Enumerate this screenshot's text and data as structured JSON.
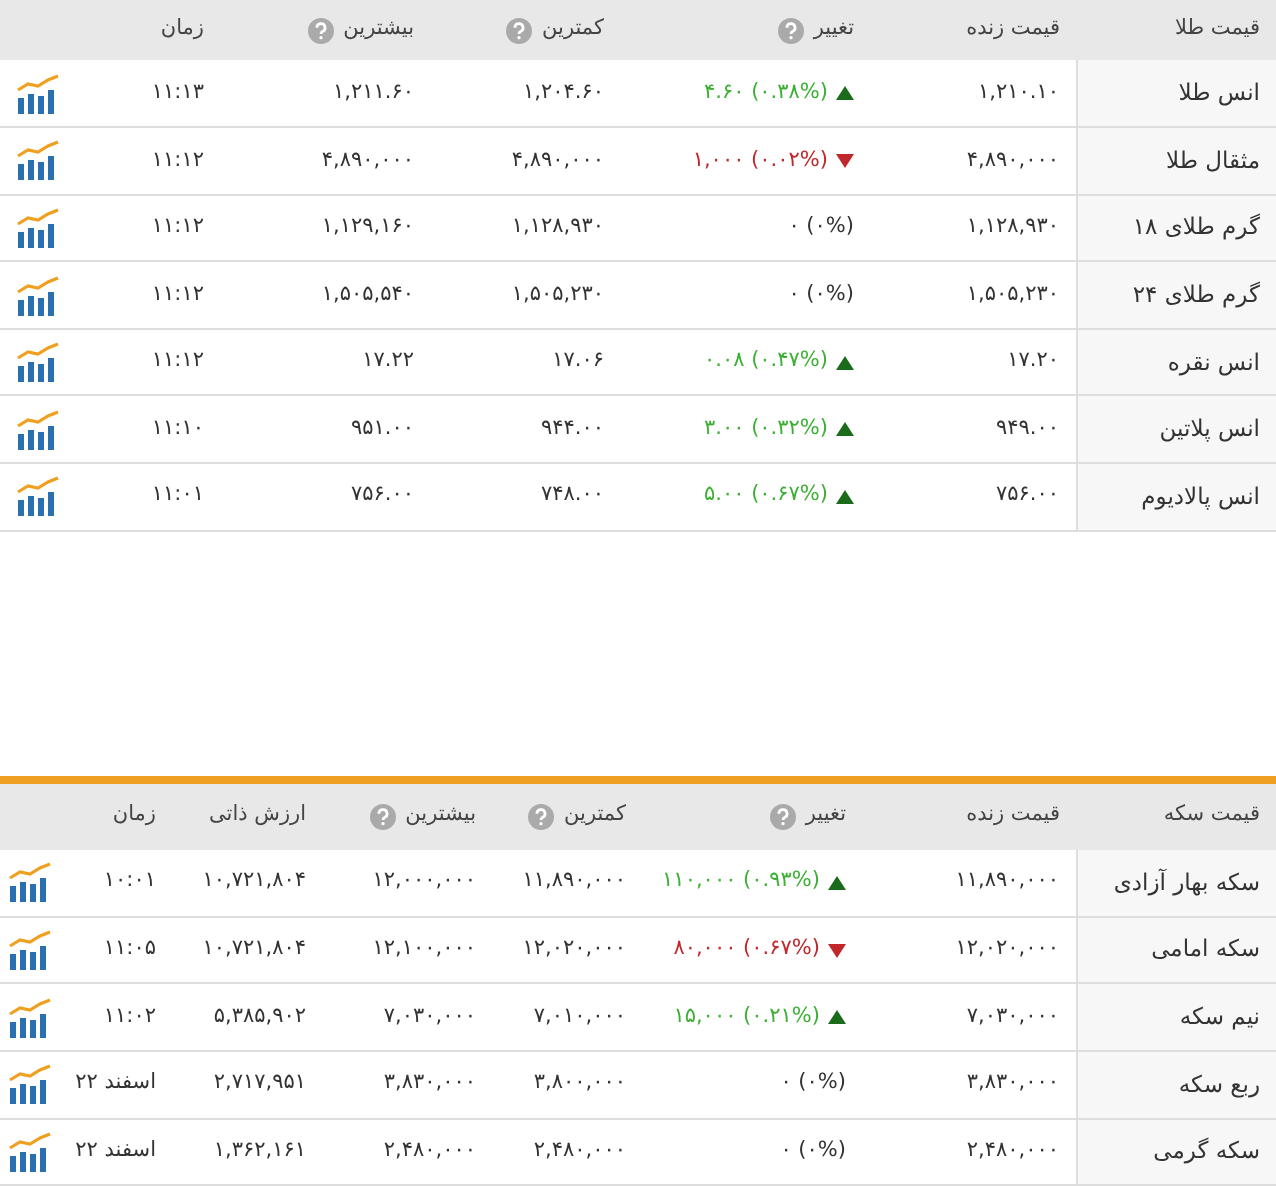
{
  "tables": [
    {
      "columns": [
        {
          "label": "قیمت طلا",
          "help": false
        },
        {
          "label": "قیمت زنده",
          "help": false
        },
        {
          "label": "تغییر",
          "help": true
        },
        {
          "label": "کمترین",
          "help": true
        },
        {
          "label": "بیشترین",
          "help": true
        },
        {
          "label": "زمان",
          "help": false
        }
      ],
      "rows": [
        {
          "rising": true,
          "falling": false,
          "cells": [
            "انس طلا",
            "۱,۲۱۰.۱۰",
            "۴.۶۰ (۰.۳۸%)",
            "۱,۲۰۴.۶۰",
            "۱,۲۱۱.۶۰",
            "۱۱:۱۳"
          ]
        },
        {
          "rising": false,
          "falling": true,
          "cells": [
            "مثقال طلا",
            "۴,۸۹۰,۰۰۰",
            "۱,۰۰۰ (۰.۰۲%)",
            "۴,۸۹۰,۰۰۰",
            "۴,۸۹۰,۰۰۰",
            "۱۱:۱۲"
          ]
        },
        {
          "rising": false,
          "falling": false,
          "cells": [
            "گرم طلای ۱۸",
            "۱,۱۲۸,۹۳۰",
            "۰ (۰%)",
            "۱,۱۲۸,۹۳۰",
            "۱,۱۲۹,۱۶۰",
            "۱۱:۱۲"
          ]
        },
        {
          "rising": false,
          "falling": false,
          "cells": [
            "گرم طلای ۲۴",
            "۱,۵۰۵,۲۳۰",
            "۰ (۰%)",
            "۱,۵۰۵,۲۳۰",
            "۱,۵۰۵,۵۴۰",
            "۱۱:۱۲"
          ]
        },
        {
          "rising": true,
          "falling": false,
          "cells": [
            "انس نقره",
            "۱۷.۲۰",
            "۰.۰۸ (۰.۴۷%)",
            "۱۷.۰۶",
            "۱۷.۲۲",
            "۱۱:۱۲"
          ]
        },
        {
          "rising": true,
          "falling": false,
          "cells": [
            "انس پلاتین",
            "۹۴۹.۰۰",
            "۳.۰۰ (۰.۳۲%)",
            "۹۴۴.۰۰",
            "۹۵۱.۰۰",
            "۱۱:۱۰"
          ]
        },
        {
          "rising": true,
          "falling": false,
          "cells": [
            "انس پالادیوم",
            "۷۵۶.۰۰",
            "۵.۰۰ (۰.۶۷%)",
            "۷۴۸.۰۰",
            "۷۵۶.۰۰",
            "۱۱:۰۱"
          ]
        }
      ]
    },
    {
      "columns": [
        {
          "label": "قیمت سکه",
          "help": false
        },
        {
          "label": "قیمت زنده",
          "help": false
        },
        {
          "label": "تغییر",
          "help": true
        },
        {
          "label": "کمترین",
          "help": true
        },
        {
          "label": "بیشترین",
          "help": true
        },
        {
          "label": "ارزش ذاتی",
          "help": false
        },
        {
          "label": "زمان",
          "help": false
        }
      ],
      "rows": [
        {
          "rising": true,
          "falling": false,
          "cells": [
            "سکه بهار آزادی",
            "۱۱,۸۹۰,۰۰۰",
            "۱۱۰,۰۰۰ (۰.۹۳%)",
            "۱۱,۸۹۰,۰۰۰",
            "۱۲,۰۰۰,۰۰۰",
            "۱۰,۷۲۱,۸۰۴",
            "۱۰:۰۱"
          ]
        },
        {
          "rising": false,
          "falling": true,
          "cells": [
            "سکه امامی",
            "۱۲,۰۲۰,۰۰۰",
            "۸۰,۰۰۰ (۰.۶۷%)",
            "۱۲,۰۲۰,۰۰۰",
            "۱۲,۱۰۰,۰۰۰",
            "۱۰,۷۲۱,۸۰۴",
            "۱۱:۰۵"
          ]
        },
        {
          "rising": true,
          "falling": false,
          "cells": [
            "نیم سکه",
            "۷,۰۳۰,۰۰۰",
            "۱۵,۰۰۰ (۰.۲۱%)",
            "۷,۰۱۰,۰۰۰",
            "۷,۰۳۰,۰۰۰",
            "۵,۳۸۵,۹۰۲",
            "۱۱:۰۲"
          ]
        },
        {
          "rising": false,
          "falling": false,
          "cells": [
            "ربع سکه",
            "۳,۸۳۰,۰۰۰",
            "۰ (۰%)",
            "۳,۸۰۰,۰۰۰",
            "۳,۸۳۰,۰۰۰",
            "۲,۷۱۷,۹۵۱",
            "۲۲ اسفند"
          ]
        },
        {
          "rising": false,
          "falling": false,
          "cells": [
            "سکه گرمی",
            "۲,۴۸۰,۰۰۰",
            "۰ (۰%)",
            "۲,۴۸۰,۰۰۰",
            "۲,۴۸۰,۰۰۰",
            "۱,۳۶۲,۱۶۱",
            "۲۲ اسفند"
          ]
        }
      ]
    }
  ]
}
